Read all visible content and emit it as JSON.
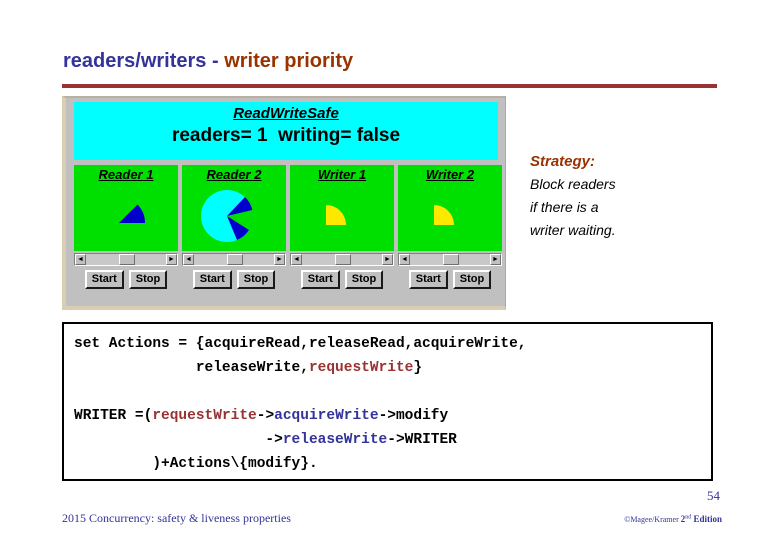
{
  "slide": {
    "title_part1": "readers/writers - ",
    "title_part2": "writer priority",
    "page_number": "54",
    "footer_left": "2015  Concurrency: safety & liveness properties",
    "footer_copyright": "©Magee/Kramer ",
    "footer_edition_num": "2",
    "footer_edition_sup": "nd",
    "footer_edition_word": " Edition"
  },
  "applet": {
    "monitor_name": "ReadWriteSafe",
    "status_line": "readers= 1  writing= false",
    "threads": [
      {
        "name": "Reader 1",
        "kind": "reader",
        "start_label": "Start",
        "stop_label": "Stop"
      },
      {
        "name": "Reader 2",
        "kind": "reader",
        "start_label": "Start",
        "stop_label": "Stop"
      },
      {
        "name": "Writer 1",
        "kind": "writer",
        "start_label": "Start",
        "stop_label": "Stop"
      },
      {
        "name": "Writer 2",
        "kind": "writer",
        "start_label": "Start",
        "stop_label": "Stop"
      }
    ],
    "scroll_left_glyph": "◄",
    "scroll_right_glyph": "►",
    "colors": {
      "panel_background": "#00e000",
      "status_background": "#00ffff",
      "reader_disc": "#00ffff",
      "reader_hand": "#0000cc",
      "writer_wedge": "#ffe800",
      "window_chrome": "#c0c0c0"
    }
  },
  "strategy": {
    "heading": "Strategy:",
    "line1": "Block readers",
    "line2": "if there is a",
    "line3": "writer waiting."
  },
  "code": {
    "line1_a": "set Actions = {acquireRead,releaseRead,acquireWrite,",
    "line2_a": "              releaseWrite,",
    "line2_b": "requestWrite",
    "line2_c": "}",
    "line3_a": "WRITER =(",
    "line3_b": "requestWrite",
    "line3_c": "->",
    "line3_d": "acquireWrite",
    "line3_e": "->modify",
    "line4_a": "                      ->",
    "line4_b": "releaseWrite",
    "line4_c": "->WRITER",
    "line5_a": "         )+Actions\\{modify}."
  }
}
